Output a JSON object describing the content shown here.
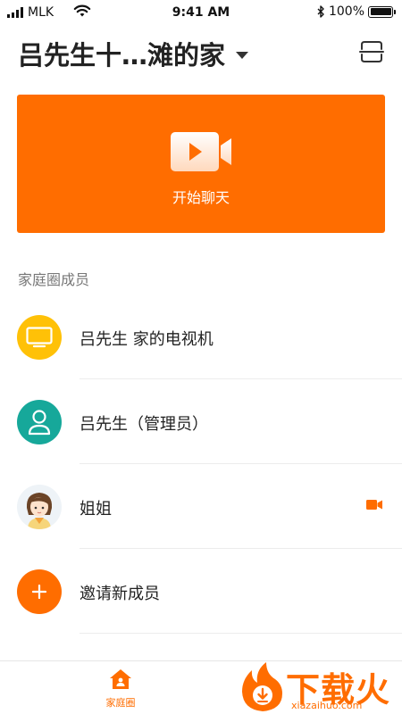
{
  "status_bar": {
    "carrier": "MLK",
    "time": "9:41 AM",
    "battery": "100%",
    "battery_level": 1.0
  },
  "header": {
    "home_name": "吕先生十…滩的家",
    "scan_icon": "scan-icon"
  },
  "chat_card": {
    "label": "开始聊天",
    "icon": "video-camera-icon",
    "color": "#ff6d00"
  },
  "members_section": {
    "title": "家庭圈成员",
    "members": [
      {
        "name": "吕先生 家的电视机",
        "avatar": "tv-icon",
        "color": "#ffc107"
      },
      {
        "name": "吕先生（管理员）",
        "avatar": "person-icon",
        "color": "#16a89a"
      },
      {
        "name": "姐姐",
        "avatar": "girl-avatar",
        "action": "video-call-icon"
      },
      {
        "name": "邀请新成员",
        "avatar": "plus-icon",
        "color": "#ff6d00"
      }
    ]
  },
  "tab_bar": {
    "tabs": [
      {
        "label": "家庭圈",
        "icon": "home-icon",
        "active": true
      }
    ]
  },
  "watermark": {
    "title": "下载火",
    "subtitle": "xiazaihuo.com"
  }
}
